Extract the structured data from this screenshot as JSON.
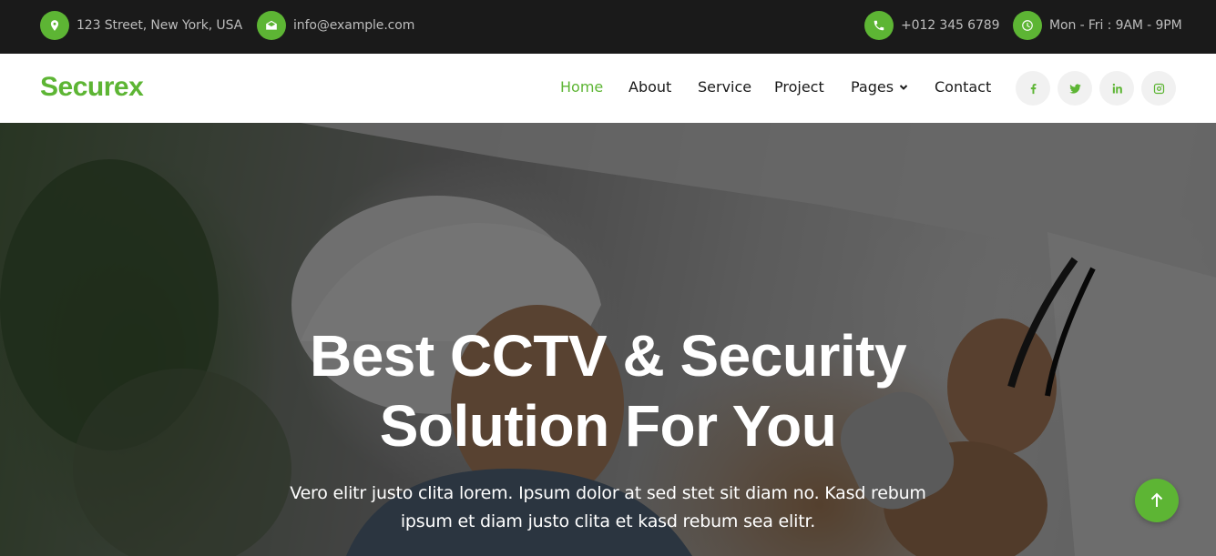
{
  "topbar": {
    "address": "123 Street, New York, USA",
    "email": "info@example.com",
    "phone": "+012 345 6789",
    "hours": "Mon - Fri : 9AM - 9PM",
    "icons": [
      "map-marker-icon",
      "envelope-icon",
      "phone-icon",
      "clock-icon"
    ]
  },
  "navbar": {
    "brand": "Securex",
    "links": [
      "Home",
      "About",
      "Service",
      "Project",
      "Pages",
      "Contact"
    ],
    "active": "Home",
    "social": [
      "facebook-icon",
      "twitter-icon",
      "linkedin-icon",
      "instagram-icon"
    ]
  },
  "hero": {
    "title_line1": "Best CCTV & Security",
    "title_line2": "Solution For You",
    "description": "Vero elitr justo clita lorem. Ipsum dolor at sed stet sit diam no. Kasd rebum ipsum et diam justo clita et kasd rebum sea elitr."
  },
  "colors": {
    "accent": "#5db534",
    "topbar_bg": "#1a1a1a",
    "text_dark": "#1a1a1a"
  }
}
